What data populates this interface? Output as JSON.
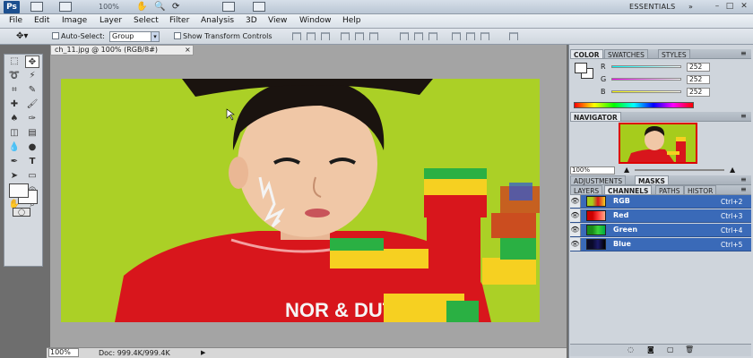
{
  "titlebar": {
    "logo": "Ps",
    "zoom": "100%",
    "workspace": "ESSENTIALS",
    "win_min": "–",
    "win_max": "□",
    "win_close": "✕"
  },
  "menu": [
    "File",
    "Edit",
    "Image",
    "Layer",
    "Select",
    "Filter",
    "Analysis",
    "3D",
    "View",
    "Window",
    "Help"
  ],
  "options": {
    "auto_select_label": "Auto-Select:",
    "auto_select_value": "Group",
    "show_transform_label": "Show Transform Controls"
  },
  "document": {
    "tab_title": "ch_11.jpg @ 100% (RGB/8#)",
    "close": "×",
    "shirt_text": "NOR & DUT"
  },
  "status": {
    "zoom": "100%",
    "doc": "Doc: 999.4K/999.4K"
  },
  "color_panel": {
    "tabs": [
      "COLOR",
      "SWATCHES",
      "STYLES"
    ],
    "r_label": "R",
    "g_label": "G",
    "b_label": "B",
    "r": "252",
    "g": "252",
    "b": "252"
  },
  "navigator": {
    "tab": "NAVIGATOR",
    "zoom": "100%"
  },
  "adjustments": {
    "tabs": [
      "ADJUSTMENTS",
      "MASKS"
    ]
  },
  "layers": {
    "tabs": [
      "LAYERS",
      "CHANNELS",
      "PATHS",
      "HISTOR"
    ],
    "channels": [
      {
        "name": "RGB",
        "shortcut": "Ctrl+2"
      },
      {
        "name": "Red",
        "shortcut": "Ctrl+3"
      },
      {
        "name": "Green",
        "shortcut": "Ctrl+4"
      },
      {
        "name": "Blue",
        "shortcut": "Ctrl+5"
      }
    ]
  },
  "colors": {
    "accent": "#3a6ab8",
    "photo_bg": "#a6cc1c",
    "shirt": "#d8161c"
  }
}
